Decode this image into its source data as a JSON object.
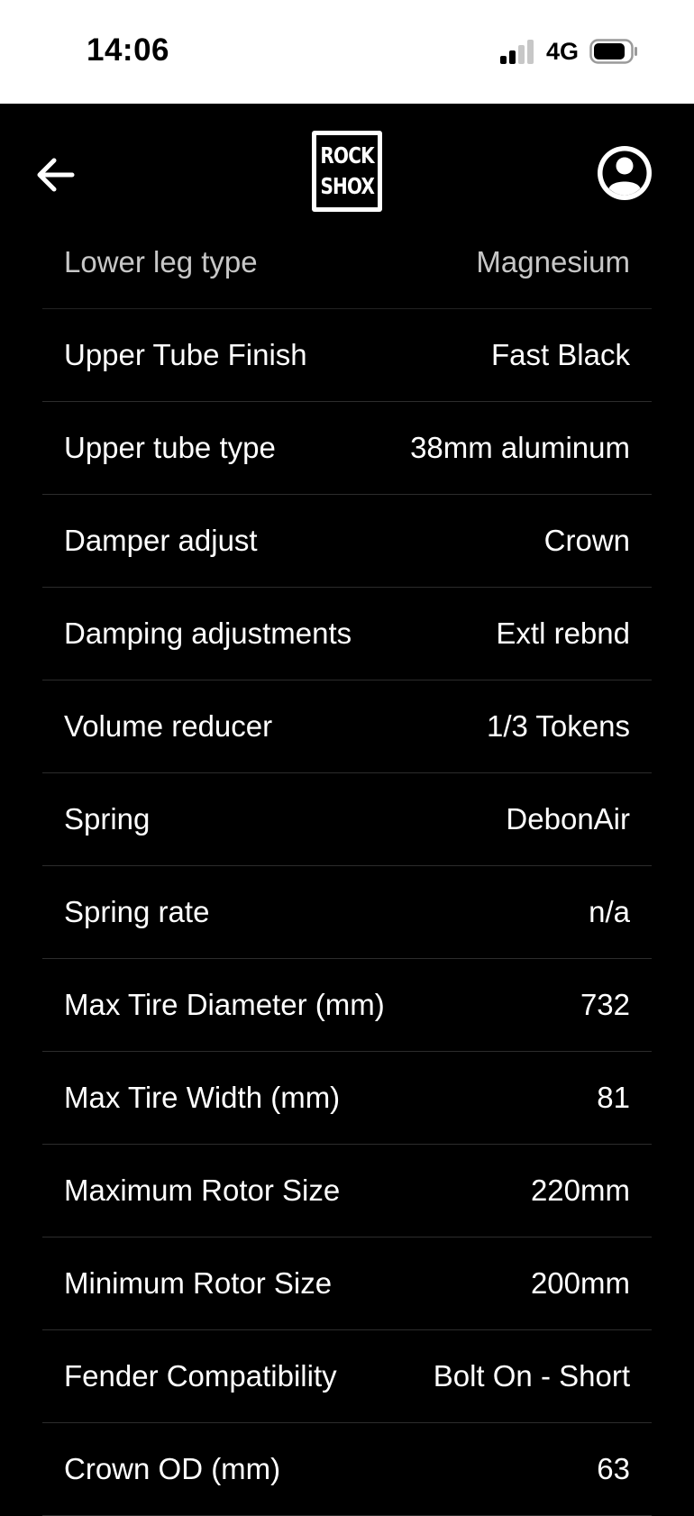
{
  "status_bar": {
    "time": "14:06",
    "network": "4G",
    "signal_icon": "cellular-signal-icon",
    "battery_icon": "battery-icon"
  },
  "header": {
    "back_icon": "arrow-left-icon",
    "logo_line_1": "ROCK",
    "logo_line_2": "SHOX",
    "profile_icon": "user-circle-icon"
  },
  "specs": [
    {
      "label": "Lower leg type",
      "value": "Magnesium"
    },
    {
      "label": "Upper Tube Finish",
      "value": "Fast Black"
    },
    {
      "label": "Upper tube type",
      "value": "38mm aluminum"
    },
    {
      "label": "Damper adjust",
      "value": "Crown"
    },
    {
      "label": "Damping adjustments",
      "value": "Extl rebnd"
    },
    {
      "label": "Volume reducer",
      "value": "1/3 Tokens"
    },
    {
      "label": "Spring",
      "value": "DebonAir"
    },
    {
      "label": "Spring rate",
      "value": "n/a"
    },
    {
      "label": "Max Tire Diameter (mm)",
      "value": "732"
    },
    {
      "label": "Max Tire Width (mm)",
      "value": "81"
    },
    {
      "label": "Maximum Rotor Size",
      "value": "220mm"
    },
    {
      "label": "Minimum Rotor Size",
      "value": "200mm"
    },
    {
      "label": "Fender Compatibility",
      "value": "Bolt On - Short"
    },
    {
      "label": "Crown OD (mm)",
      "value": "63"
    }
  ],
  "colors": {
    "background": "#000000",
    "status_bar": "#ffffff",
    "divider": "#2c2c2c",
    "text": "#ffffff"
  }
}
